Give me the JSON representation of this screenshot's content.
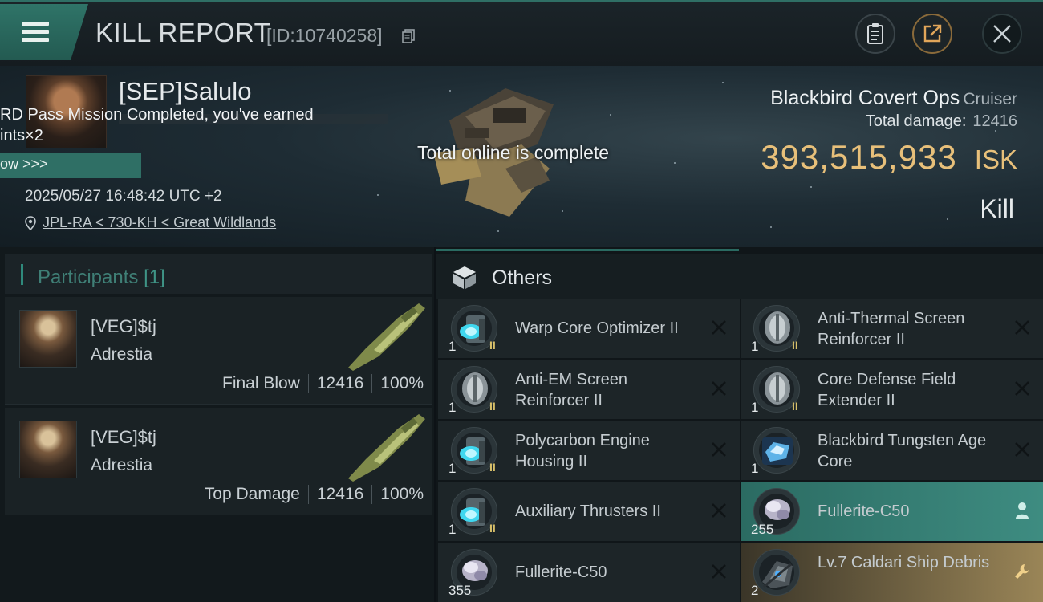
{
  "header": {
    "title": "KILL REPORT",
    "report_id": "[ID:10740258]",
    "icons": [
      "menu-icon",
      "copy-icon",
      "clipboard-icon",
      "share-icon",
      "close-icon"
    ]
  },
  "banner": {
    "pilot_name": "[SEP]Salulo",
    "notice_text": "RD Pass Mission Completed, you've earned\nints×2",
    "notice_button": "ow >>>",
    "kill_time": "2025/05/27 16:48:42 UTC +2",
    "location": "JPL-RA < 730-KH < Great Wildlands",
    "toast": "Total online is complete",
    "ship_name": "Blackbird Covert Ops",
    "ship_class": "Cruiser",
    "total_damage_label": "Total damage:",
    "total_damage_value": "12416",
    "isk_value": "393,515,933",
    "isk_unit": "ISK",
    "result": "Kill"
  },
  "participants": {
    "label": "Participants",
    "count": "[1]",
    "rows": [
      {
        "name": "[VEG]$tj",
        "ship": "Adrestia",
        "role": "Final Blow",
        "damage": "12416",
        "percent": "100%"
      },
      {
        "name": "[VEG]$tj",
        "ship": "Adrestia",
        "role": "Top Damage",
        "damage": "12416",
        "percent": "100%"
      }
    ]
  },
  "items": {
    "label": "Others",
    "list": [
      {
        "name": "Warp Core Optimizer II",
        "qty": "1",
        "meta": "II",
        "icon": "module-blue-icon",
        "action": "destroyed"
      },
      {
        "name": "Anti-Thermal Screen Reinforcer II",
        "qty": "1",
        "meta": "II",
        "icon": "shield-module-icon",
        "action": "destroyed"
      },
      {
        "name": "Anti-EM Screen Reinforcer II",
        "qty": "1",
        "meta": "II",
        "icon": "shield-module-icon",
        "action": "destroyed"
      },
      {
        "name": "Core Defense Field Extender II",
        "qty": "1",
        "meta": "II",
        "icon": "shield-module-icon",
        "action": "destroyed"
      },
      {
        "name": "Polycarbon Engine Housing II",
        "qty": "1",
        "meta": "II",
        "icon": "module-blue-icon",
        "action": "destroyed"
      },
      {
        "name": "Blackbird Tungsten Age Core",
        "qty": "1",
        "meta": "",
        "icon": "core-icon",
        "action": "destroyed"
      },
      {
        "name": "Auxiliary Thrusters II",
        "qty": "1",
        "meta": "II",
        "icon": "module-blue-icon",
        "action": "destroyed"
      },
      {
        "name": "Fullerite-C50",
        "qty": "255",
        "meta": "",
        "icon": "gas-icon",
        "action": "dropped"
      },
      {
        "name": "Fullerite-C50",
        "qty": "355",
        "meta": "",
        "icon": "gas-icon",
        "action": "destroyed"
      },
      {
        "name": "Lv.7 Caldari Ship Debris",
        "qty": "2",
        "meta": "",
        "icon": "debris-icon",
        "action": "salvage"
      }
    ]
  },
  "colors": {
    "accent": "#2f6f65",
    "isk_gold": "#e8c07a",
    "dropped_row": "#3e8c81",
    "salvage_row": "#9a8557"
  }
}
